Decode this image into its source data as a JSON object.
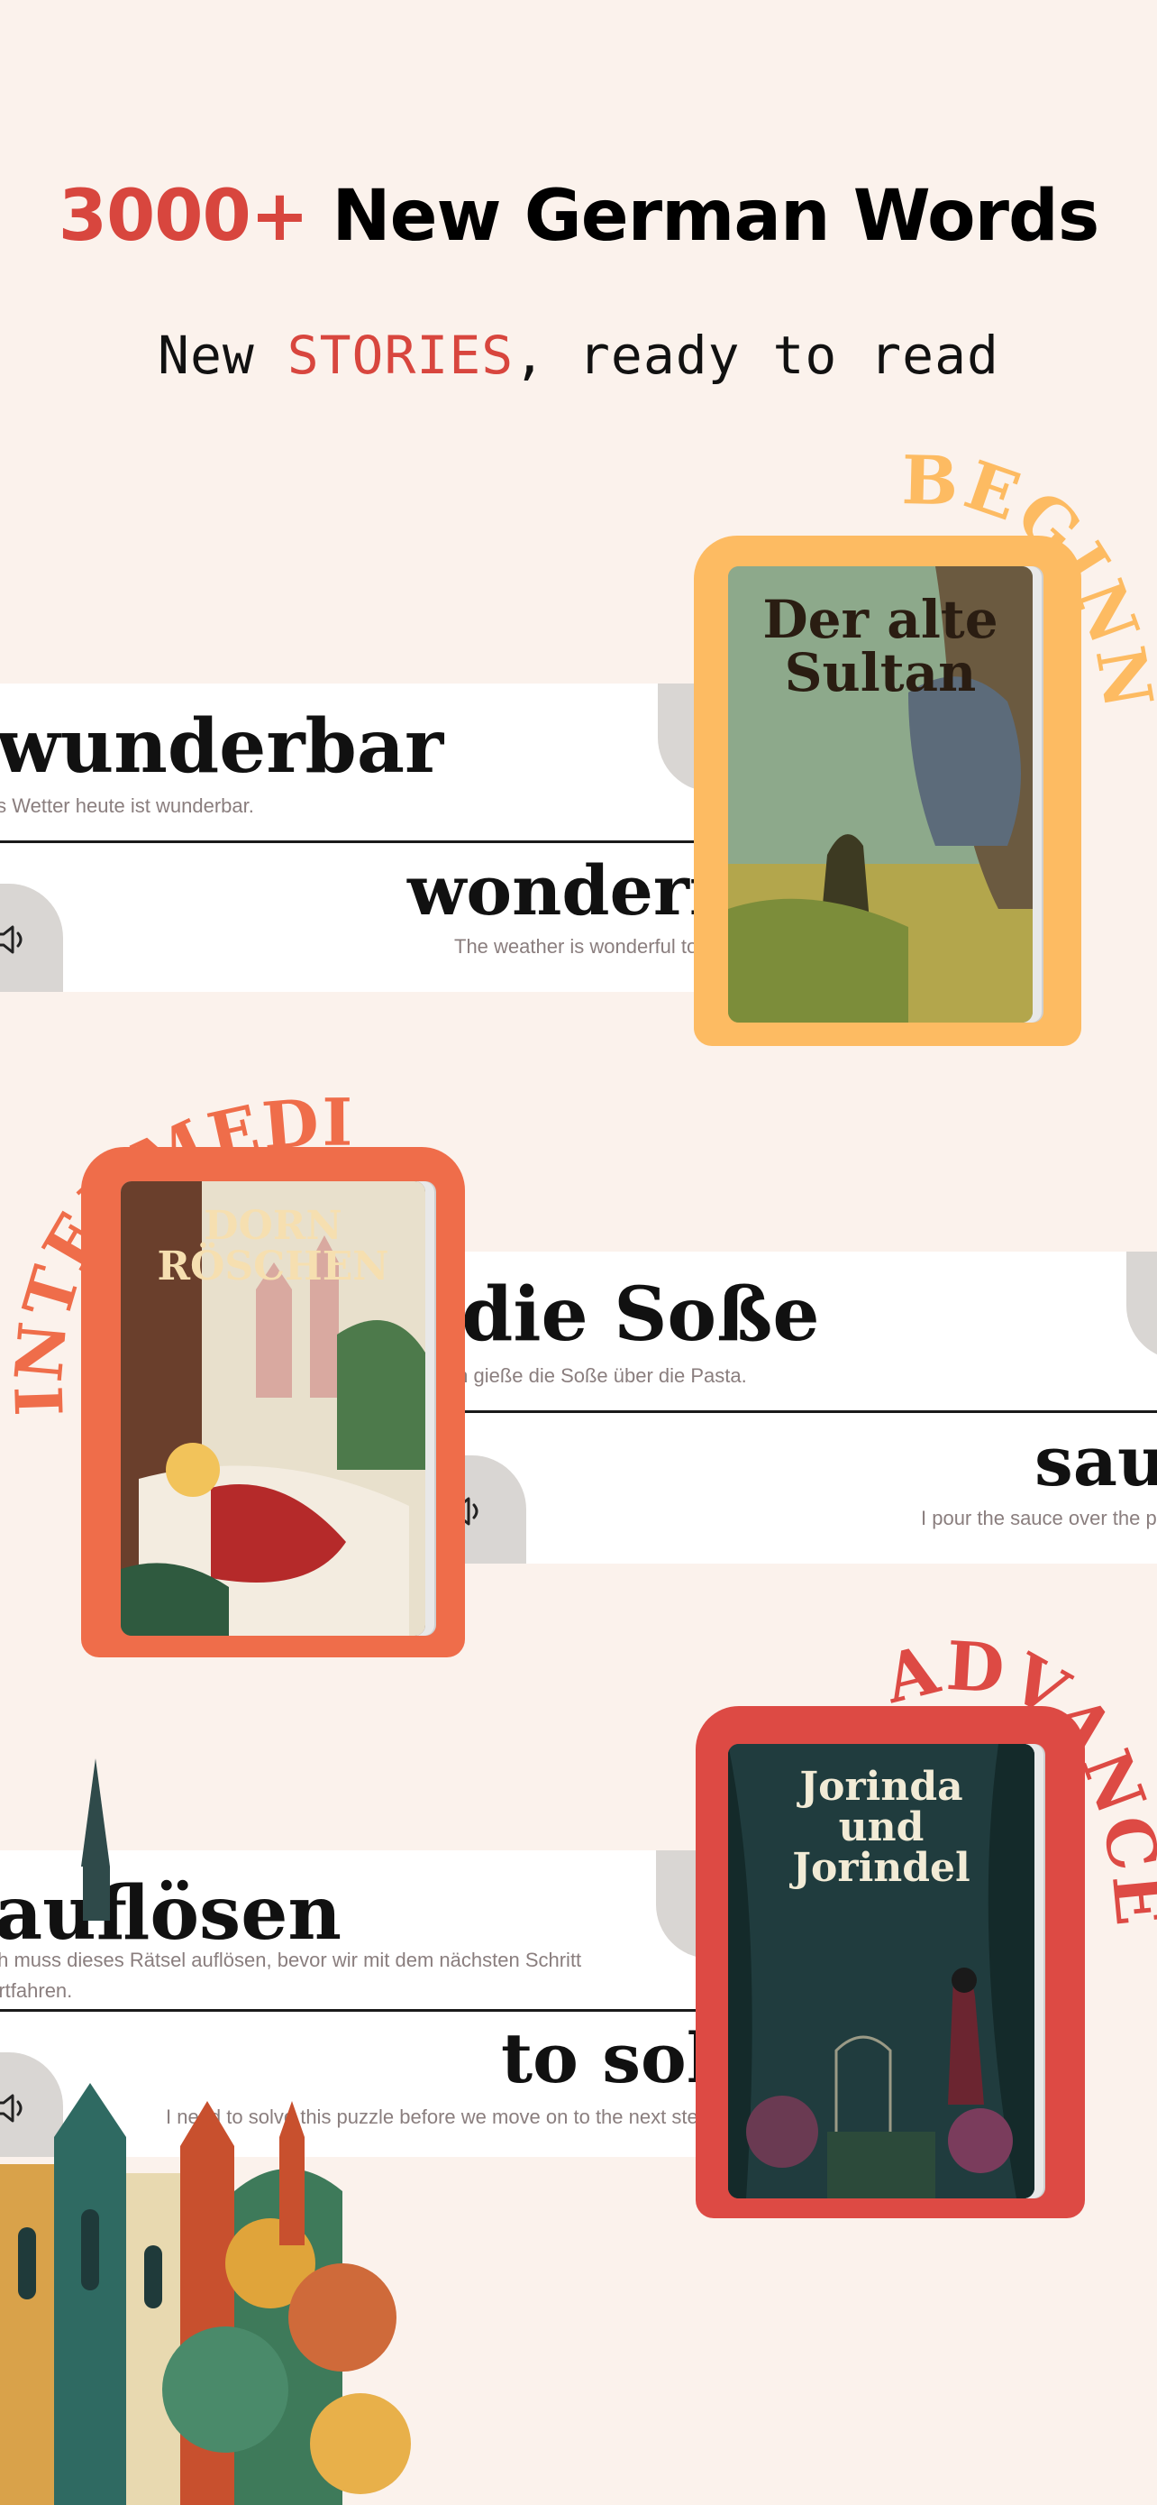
{
  "header": {
    "title_num": "3000+",
    "title_rest": "New German Words",
    "sub_pre": "New",
    "sub_highlight": "STORIES",
    "sub_post": ", ready to read",
    "accent_color": "#d8463e"
  },
  "cards": [
    {
      "word": "wunderbar",
      "sentence": "Das Wetter heute ist wunderbar.",
      "translation": "wonderful",
      "translation_sentence": "The weather is wonderful today."
    },
    {
      "word": "die Soße",
      "sentence": "Ich gieße die Soße über die Pasta.",
      "translation": "sauce",
      "translation_sentence": "I pour the sauce over the pasta."
    },
    {
      "word": "auflösen",
      "sentence_line1": "Ich muss dieses Rätsel auflösen, bevor wir mit dem nächsten Schritt",
      "sentence_line2": "fortfahren.",
      "translation": "to solve",
      "translation_sentence": "I need to solve this puzzle before we move on to the next step."
    }
  ],
  "books": [
    {
      "level": "BEGINNER",
      "title_line1": "Der alte",
      "title_line2": "Sultan",
      "frame_color": "#fdbb62"
    },
    {
      "level": "INTERMEDIATE",
      "title_line1": "DORN",
      "title_line2": "RÖSCHEN",
      "frame_color": "#ef6d4a"
    },
    {
      "level": "ADVANCED",
      "title_line1": "Jorinda",
      "title_line2": "und",
      "title_line3": "Jorindel",
      "frame_color": "#dd4a44"
    }
  ],
  "icons": [
    "speaker-icon"
  ]
}
